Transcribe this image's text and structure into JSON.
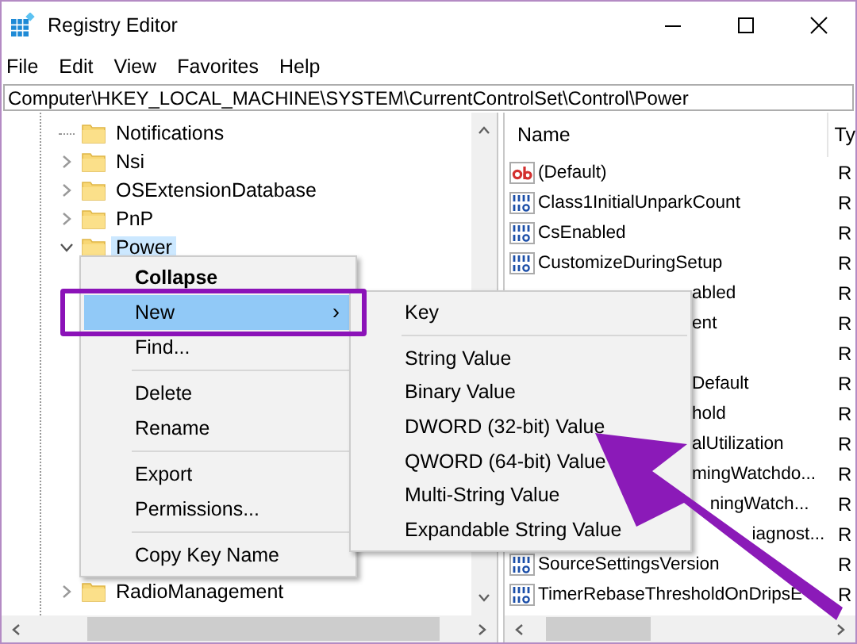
{
  "window": {
    "title": "Registry Editor"
  },
  "menu_bar": [
    "File",
    "Edit",
    "View",
    "Favorites",
    "Help"
  ],
  "address": "Computer\\HKEY_LOCAL_MACHINE\\SYSTEM\\CurrentControlSet\\Control\\Power",
  "tree": {
    "items": [
      {
        "label": "Notifications",
        "has_children": false,
        "selected": false
      },
      {
        "label": "Nsi",
        "has_children": true,
        "expanded": false,
        "selected": false
      },
      {
        "label": "OSExtensionDatabase",
        "has_children": true,
        "expanded": false,
        "selected": false
      },
      {
        "label": "PnP",
        "has_children": true,
        "expanded": false,
        "selected": false
      },
      {
        "label": "Power",
        "has_children": true,
        "expanded": true,
        "selected": true
      },
      {
        "label": "RadioManagement",
        "has_children": true,
        "expanded": false,
        "selected": false
      }
    ]
  },
  "values": {
    "columns": [
      "Name",
      "Ty"
    ],
    "rows": [
      {
        "kind": "string",
        "name": "(Default)",
        "type": "R",
        "covered": false
      },
      {
        "kind": "dword",
        "name": "Class1InitialUnparkCount",
        "type": "R",
        "covered": false
      },
      {
        "kind": "dword",
        "name": "CsEnabled",
        "type": "R",
        "covered": false
      },
      {
        "kind": "dword",
        "name": "CustomizeDuringSetup",
        "type": "R",
        "covered": false
      },
      {
        "name": "abled",
        "type": "R",
        "covered": true
      },
      {
        "name": "ent",
        "type": "R",
        "covered": true
      },
      {
        "type": "R"
      },
      {
        "name": "Default",
        "type": "R",
        "covered": true
      },
      {
        "name": "hold",
        "type": "R",
        "covered": true
      },
      {
        "name": "alUtilization",
        "type": "R",
        "covered": true
      },
      {
        "name": "mingWatchdo...",
        "type": "R",
        "covered": true
      },
      {
        "name": "ningWatch...",
        "type": "R",
        "covered": true
      },
      {
        "name": "iagnost...",
        "type": "R",
        "covered": true
      },
      {
        "kind": "dword",
        "name": "SourceSettingsVersion",
        "type": "R",
        "covered": false
      },
      {
        "kind": "dword",
        "name": "TimerRebaseThresholdOnDripsE",
        "type": "R",
        "covered": false
      }
    ]
  },
  "context_menu": {
    "items": [
      {
        "kind": "item",
        "label": "Collapse",
        "default": true,
        "selected": false
      },
      {
        "kind": "item",
        "label": "New",
        "default": false,
        "selected": true,
        "arrow": "›"
      },
      {
        "kind": "item",
        "label": "Find...",
        "default": false,
        "selected": false
      },
      {
        "kind": "separator"
      },
      {
        "kind": "item",
        "label": "Delete",
        "default": false,
        "selected": false
      },
      {
        "kind": "item",
        "label": "Rename",
        "default": false,
        "selected": false
      },
      {
        "kind": "separator"
      },
      {
        "kind": "item",
        "label": "Export",
        "default": false,
        "selected": false
      },
      {
        "kind": "item",
        "label": "Permissions...",
        "default": false,
        "selected": false
      },
      {
        "kind": "separator"
      },
      {
        "kind": "item",
        "label": "Copy Key Name",
        "default": false,
        "selected": false
      }
    ]
  },
  "submenu": {
    "items": [
      {
        "kind": "item",
        "label": "Key"
      },
      {
        "kind": "separator"
      },
      {
        "kind": "item",
        "label": "String Value"
      },
      {
        "kind": "item",
        "label": "Binary Value"
      },
      {
        "kind": "item",
        "label": "DWORD (32-bit) Value"
      },
      {
        "kind": "item",
        "label": "QWORD (64-bit) Value"
      },
      {
        "kind": "item",
        "label": "Multi-String Value"
      },
      {
        "kind": "item",
        "label": "Expandable String Value"
      }
    ]
  }
}
